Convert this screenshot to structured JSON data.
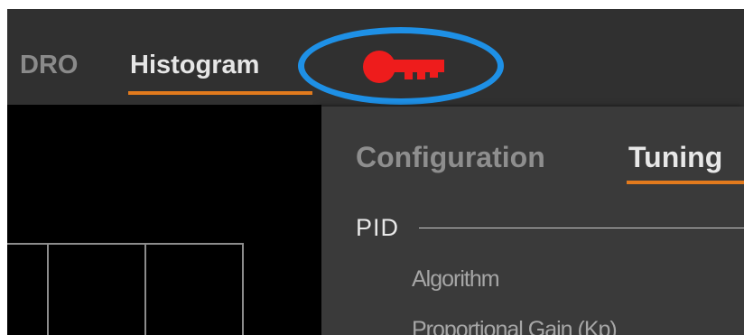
{
  "top_tabs": {
    "dro": "DRO",
    "histogram": "Histogram"
  },
  "key_icon": {
    "name": "key-icon",
    "color": "#ee1c1c"
  },
  "highlight_color": "#1e90e6",
  "accent_color": "#e27a1d",
  "panel": {
    "tabs": {
      "configuration": "Configuration",
      "tuning": "Tuning"
    },
    "section": "PID",
    "fields": {
      "algorithm": "Algorithm",
      "proportional_gain": "Proportional Gain (Kp)"
    }
  }
}
